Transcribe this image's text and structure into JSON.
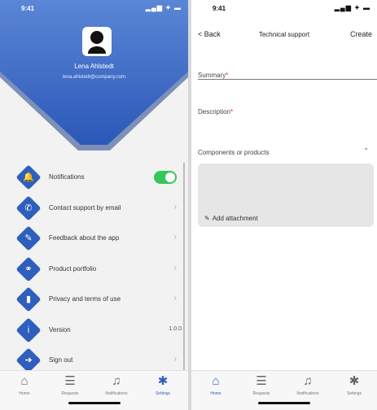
{
  "colors": {
    "accent": "#2f5fbd",
    "toggle_on": "#36c759",
    "required": "#d32f2f"
  },
  "left": {
    "status": {
      "time": "9:41",
      "icons": "▂▄▆ ✦ ▬"
    },
    "profile": {
      "name": "Lena Ahlstedt",
      "subtitle": "lena.ahlstedt@company.com"
    },
    "menu": [
      {
        "label": "Notifications",
        "icon": "bell-icon",
        "glyph": "🔔",
        "control": "toggle",
        "on": true
      },
      {
        "label": "Contact support by email",
        "icon": "phone-icon",
        "glyph": "✆",
        "control": "chevron"
      },
      {
        "label": "Feedback about the app",
        "icon": "edit-icon",
        "glyph": "✎",
        "control": "chevron"
      },
      {
        "label": "Product portfolio",
        "icon": "link-icon",
        "glyph": "⚭",
        "control": "chevron"
      },
      {
        "label": "Privacy and terms of use",
        "icon": "trash-icon",
        "glyph": "▮",
        "control": "chevron"
      },
      {
        "label": "Version",
        "icon": "info-icon",
        "glyph": "i",
        "control": "value",
        "value": "1.0.0"
      },
      {
        "label": "Sign out",
        "icon": "sign-out-icon",
        "glyph": "➜",
        "control": "chevron"
      }
    ],
    "chevron": "›",
    "tabs": [
      {
        "label": "Home",
        "icon": "home-icon",
        "glyph": "⌂"
      },
      {
        "label": "Requests",
        "icon": "requests-icon",
        "glyph": "☰"
      },
      {
        "label": "Notifications",
        "icon": "bell-outline-icon",
        "glyph": "♫"
      },
      {
        "label": "Settings",
        "icon": "settings-icon",
        "glyph": "✱",
        "active": true
      }
    ]
  },
  "right": {
    "status": {
      "time": "9:41",
      "icons": "▂▄▆ ✦ ▬"
    },
    "nav": {
      "back": "< Back",
      "title": "Technical support",
      "action": "Create"
    },
    "fields": {
      "summary": {
        "label": "Summary",
        "required": "*"
      },
      "description": {
        "label": "Description",
        "required": "*"
      },
      "components": {
        "label": "Components or products",
        "caret": "⌄"
      }
    },
    "attachment": {
      "label": "Add attachment",
      "icon": "paperclip-icon",
      "glyph": "✎"
    },
    "tabs": [
      {
        "label": "Home",
        "icon": "home-icon",
        "glyph": "⌂",
        "active": true
      },
      {
        "label": "Requests",
        "icon": "requests-icon",
        "glyph": "☰"
      },
      {
        "label": "Notifications",
        "icon": "bell-outline-icon",
        "glyph": "♫"
      },
      {
        "label": "Settings",
        "icon": "settings-icon",
        "glyph": "✱"
      }
    ]
  }
}
